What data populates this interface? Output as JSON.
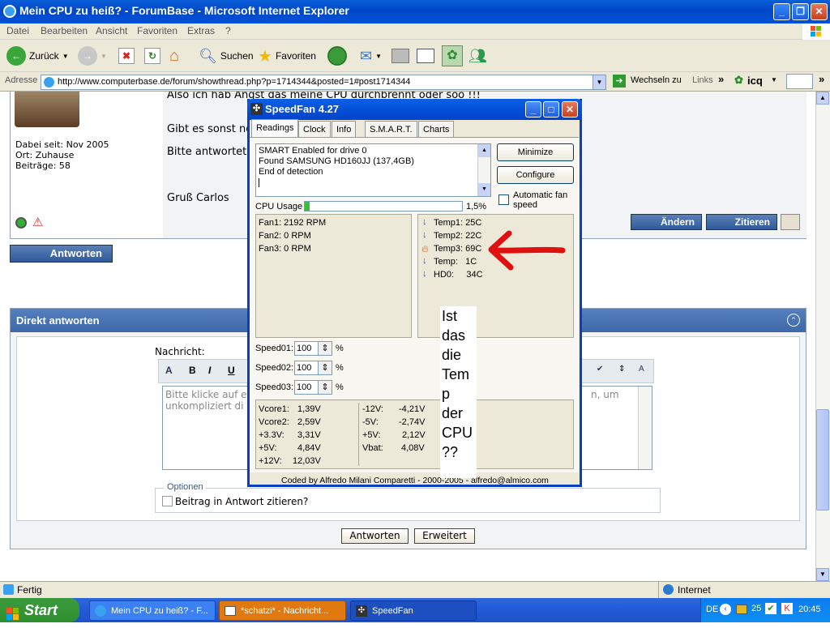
{
  "window": {
    "title": "Mein CPU zu heiß? - ForumBase - Microsoft Internet Explorer"
  },
  "menu": [
    "Datei",
    "Bearbeiten",
    "Ansicht",
    "Favoriten",
    "Extras",
    "?"
  ],
  "toolbar": {
    "back": "Zurück",
    "search": "Suchen",
    "favorites": "Favoriten"
  },
  "address": {
    "label": "Adresse",
    "url": "http://www.computerbase.de/forum/showthread.php?p=1714344&posted=1#post1714344",
    "go": "Wechseln zu",
    "links": "Links",
    "icq": "icq"
  },
  "post": {
    "line1": "Also ich hab Angst das meine CPU durchbrennt oder soo !!!",
    "line2": "Gibt es sonst no",
    "line3": "Bitte antwortet",
    "line4": "Gruß Carlos",
    "member_since": "Dabei seit: Nov 2005",
    "location": "Ort: Zuhause",
    "posts": "Beiträge: 58",
    "edit_button": "Ändern",
    "quote_button": "Zitieren"
  },
  "reply_button": "Antworten",
  "quick_reply": {
    "title": "Direkt antworten",
    "message_label": "Nachricht:",
    "placeholder_left": "Bitte klicke auf e",
    "placeholder_left2": "unkompliziert di",
    "placeholder_right": "n, um",
    "options_label": "Optionen",
    "quote_option": "Beitrag in Antwort zitieren?",
    "submit": "Antworten",
    "advanced": "Erweitert"
  },
  "speedfan": {
    "title": "SpeedFan 4.27",
    "tabs": [
      "Readings",
      "Clock",
      "Info",
      "S.M.A.R.T.",
      "Charts"
    ],
    "log": [
      "SMART Enabled for drive 0",
      "Found SAMSUNG HD160JJ (137,4GB)",
      "End of detection"
    ],
    "buttons": {
      "minimize": "Minimize",
      "configure": "Configure"
    },
    "auto_fan": "Automatic fan speed",
    "cpu_usage_label": "CPU Usage",
    "cpu_usage_value": "1,5%",
    "cpu_usage_fraction": 0.015,
    "fans": [
      "Fan1: 2192 RPM",
      "Fan2: 0 RPM",
      "Fan3: 0 RPM"
    ],
    "temps": [
      "Temp1: 25C",
      "Temp2: 22C",
      "Temp3: 69C",
      "Temp:   1C",
      "HD0:     34C"
    ],
    "speeds": [
      {
        "label": "Speed01:",
        "value": "100"
      },
      {
        "label": "Speed02:",
        "value": "100"
      },
      {
        "label": "Speed03:",
        "value": "100"
      }
    ],
    "percent": "%",
    "voltages_left": [
      {
        "name": "Vcore1:",
        "value": "1,39V"
      },
      {
        "name": "Vcore2:",
        "value": "2,59V"
      },
      {
        "name": "+3.3V:",
        "value": "3,31V"
      },
      {
        "name": "+5V:",
        "value": "4,84V"
      },
      {
        "name": "+12V:",
        "value": "12,03V"
      }
    ],
    "voltages_right": [
      {
        "name": "-12V:",
        "value": "-4,21V"
      },
      {
        "name": "-5V:",
        "value": "-2,74V"
      },
      {
        "name": "+5V:",
        "value": "2,12V"
      },
      {
        "name": "Vbat:",
        "value": "4,08V"
      }
    ],
    "footer": "Coded by Alfredo Milani Comparetti - 2000-2005 - alfredo@almico.com"
  },
  "annotation": {
    "lines": [
      "Ist",
      "das",
      "die",
      "Tem",
      "p",
      "der",
      "CPU",
      "??"
    ],
    "arrow_color": "#e11010"
  },
  "status": {
    "text": "Fertig",
    "zone": "Internet"
  },
  "taskbar": {
    "start": "Start",
    "tasks": [
      "Mein CPU zu heiß? - F...",
      "*schatzi* - Nachricht...",
      "SpeedFan"
    ],
    "lang": "DE",
    "tray_number": "25",
    "clock": "20:45"
  }
}
